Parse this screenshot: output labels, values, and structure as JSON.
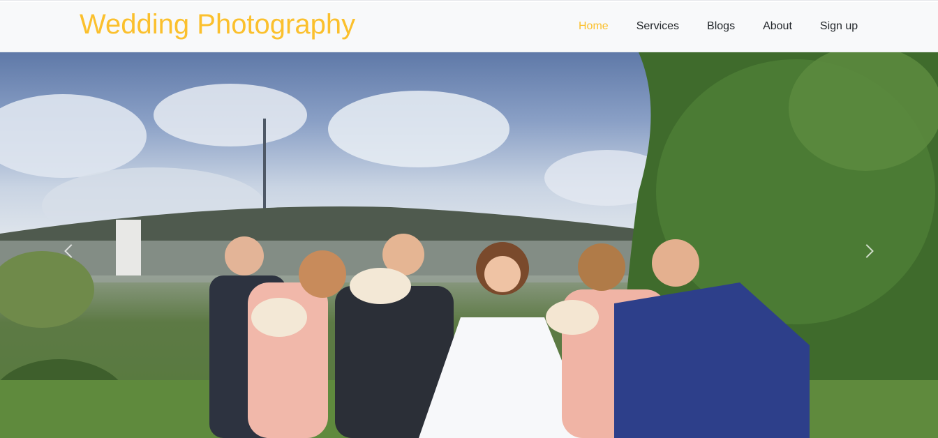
{
  "brand": {
    "name": "Wedding Photography",
    "color": "#fbc02d"
  },
  "nav": {
    "items": [
      {
        "label": "Home",
        "active": true
      },
      {
        "label": "Services",
        "active": false
      },
      {
        "label": "Blogs",
        "active": false
      },
      {
        "label": "About",
        "active": false
      },
      {
        "label": "Sign up",
        "active": false
      }
    ]
  },
  "hero": {
    "image_subject": "wedding party celebrating outdoors",
    "controls": {
      "prev_icon": "chevron-left-icon",
      "next_icon": "chevron-right-icon"
    }
  }
}
